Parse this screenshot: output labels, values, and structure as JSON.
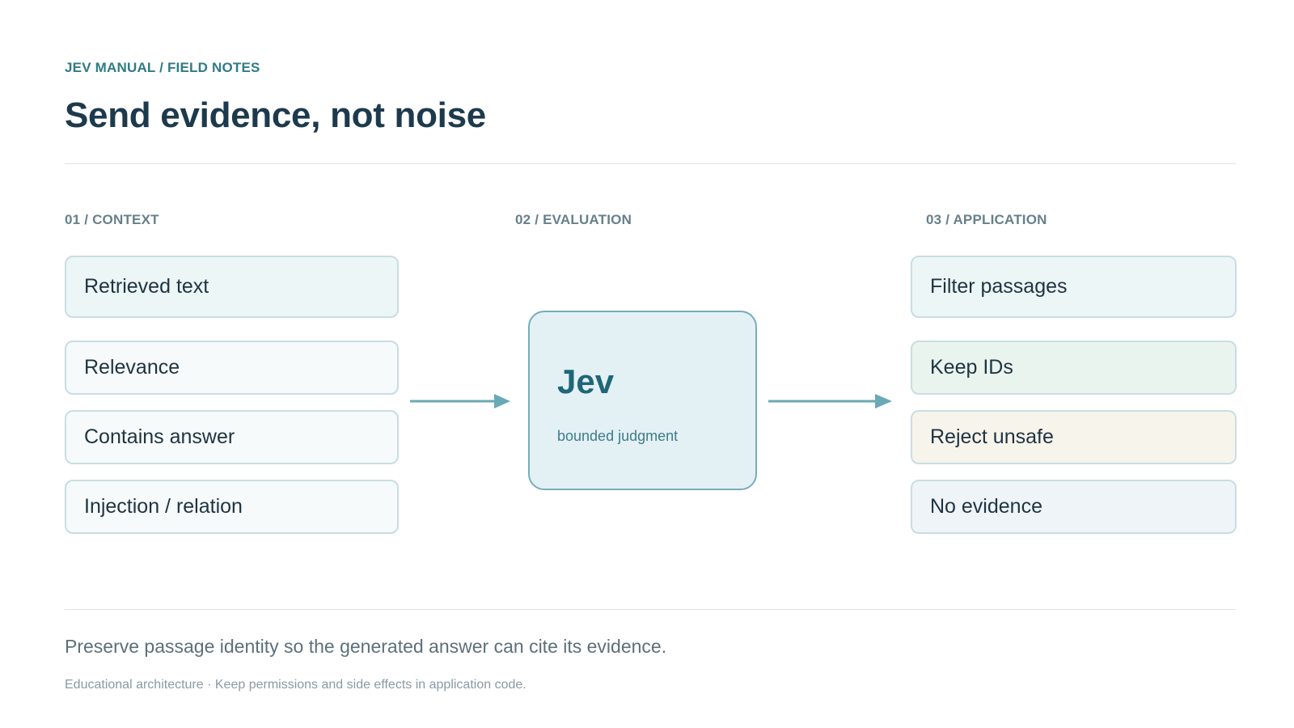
{
  "header": {
    "eyebrow": "JEV MANUAL / FIELD NOTES",
    "title": "Send evidence, not noise"
  },
  "sections": {
    "context": {
      "label": "01 / CONTEXT",
      "items": [
        "Retrieved text",
        "Relevance",
        "Contains answer",
        "Injection / relation"
      ]
    },
    "evaluation": {
      "label": "02 / EVALUATION",
      "node_title": "Jev",
      "node_subtitle": "bounded judgment"
    },
    "application": {
      "label": "03 / APPLICATION",
      "items": [
        "Filter passages",
        "Keep IDs",
        "Reject unsafe",
        "No evidence"
      ]
    }
  },
  "footer": {
    "caption": "Preserve passage identity so the generated answer can cite its evidence.",
    "note": "Educational architecture · Keep permissions and side effects in application code."
  },
  "colors": {
    "accent": "#2f7b86",
    "title": "#1d3a4d",
    "arrow": "#6aa9b6",
    "keep_ids_bg": "#eaf4ee",
    "reject_unsafe_bg": "#f7f4ec",
    "no_evidence_bg": "#eef4f8"
  }
}
